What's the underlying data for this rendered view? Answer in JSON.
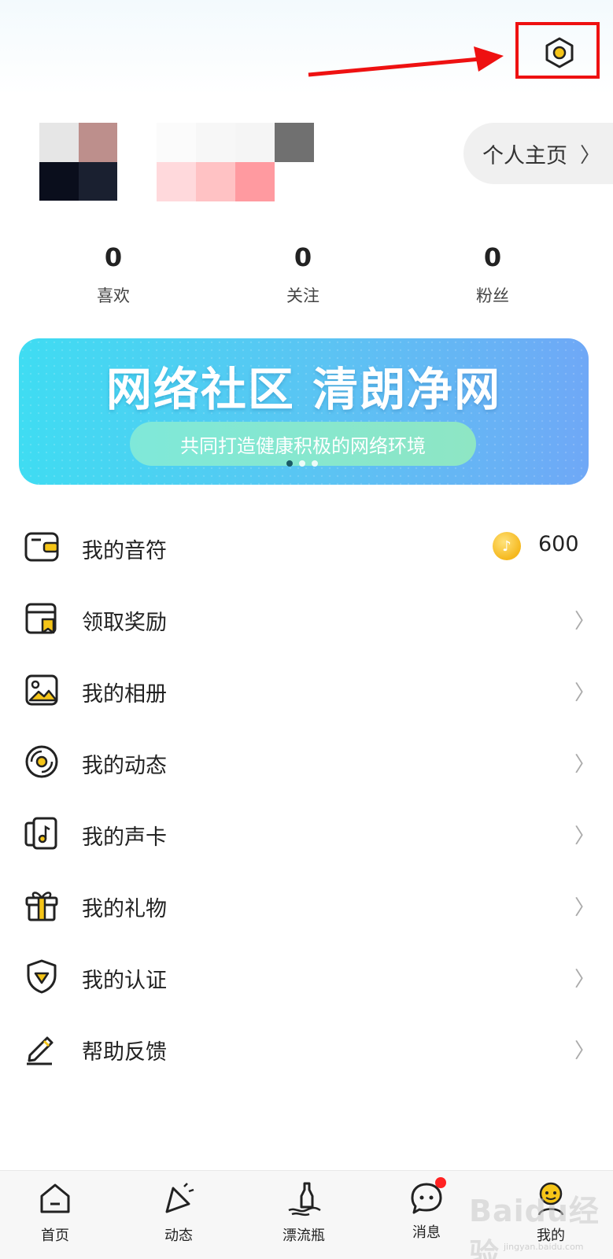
{
  "profile": {
    "homepage_label": "个人主页"
  },
  "stats": [
    {
      "value": "0",
      "label": "喜欢"
    },
    {
      "value": "0",
      "label": "关注"
    },
    {
      "value": "0",
      "label": "粉丝"
    }
  ],
  "banner": {
    "title": "网络社区 清朗净网",
    "subtitle": "共同打造健康积极的网络环境",
    "page_count": 3,
    "active_page": 1
  },
  "menu": {
    "items": [
      {
        "label": "我的音符",
        "icon": "wallet-icon",
        "coin_value": "600"
      },
      {
        "label": "领取奖励",
        "icon": "reward-icon"
      },
      {
        "label": "我的相册",
        "icon": "photo-album-icon"
      },
      {
        "label": "我的动态",
        "icon": "vinyl-disc-icon"
      },
      {
        "label": "我的声卡",
        "icon": "music-card-icon"
      },
      {
        "label": "我的礼物",
        "icon": "gift-icon"
      },
      {
        "label": "我的认证",
        "icon": "shield-check-icon"
      },
      {
        "label": "帮助反馈",
        "icon": "pencil-icon"
      }
    ]
  },
  "bottom_nav": [
    {
      "label": "首页",
      "icon": "home-icon"
    },
    {
      "label": "动态",
      "icon": "party-icon"
    },
    {
      "label": "漂流瓶",
      "icon": "bottle-icon"
    },
    {
      "label": "消息",
      "icon": "chat-icon",
      "has_badge": true
    },
    {
      "label": "我的",
      "icon": "me-icon",
      "active": true
    }
  ],
  "watermark": {
    "text": "Baidu经验",
    "sub": "jingyan.baidu.com"
  },
  "colors": {
    "accent_yellow": "#f5c518",
    "annotation_red": "#e11111",
    "badge_red": "#ff2222"
  }
}
